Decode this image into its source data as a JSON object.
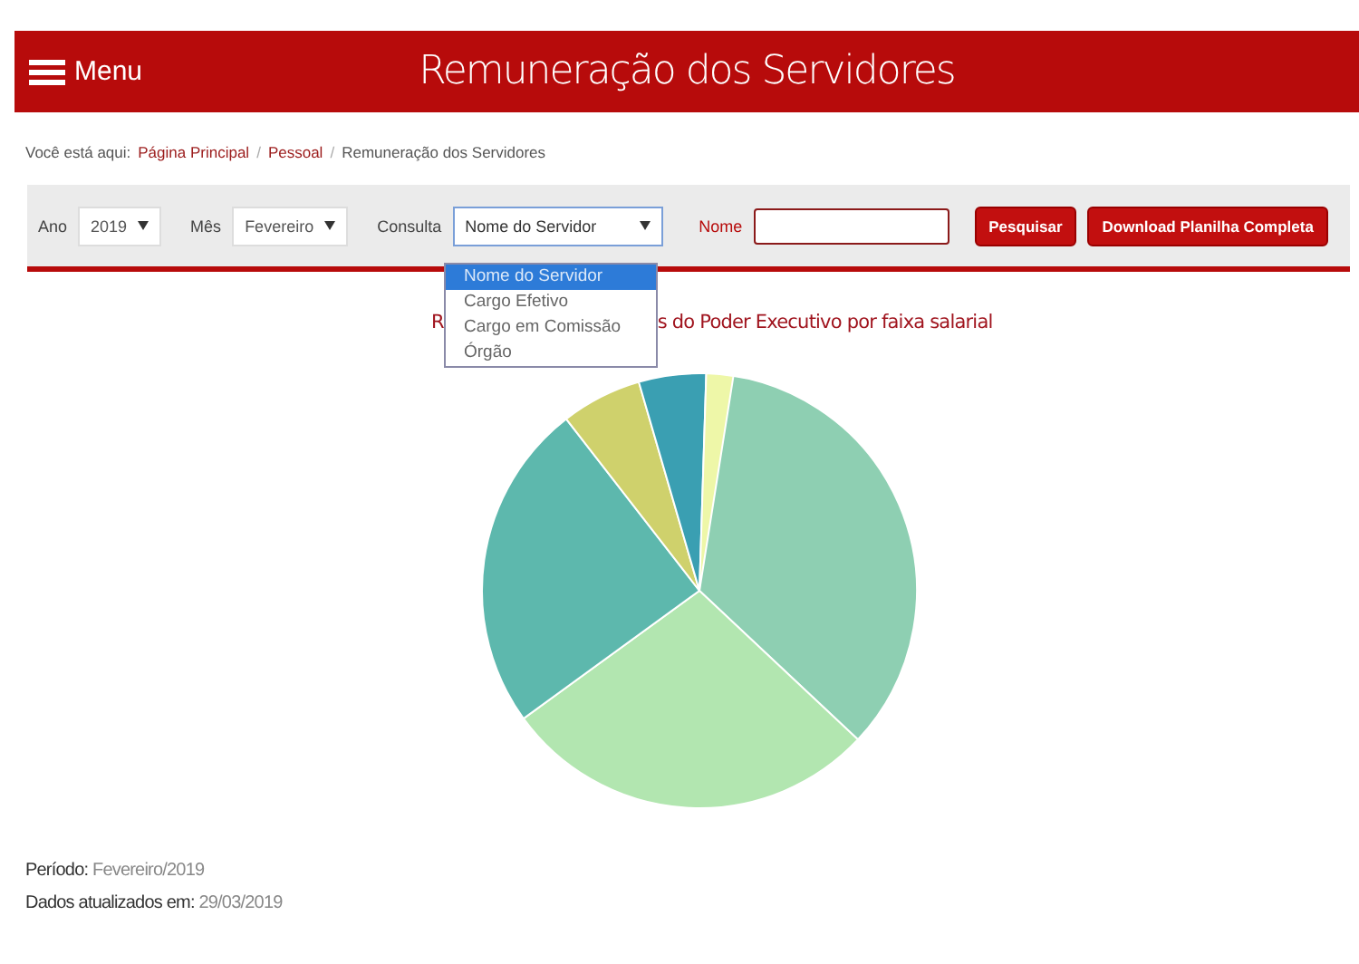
{
  "header": {
    "menu_label": "Menu",
    "title": "Remuneração dos Servidores"
  },
  "breadcrumb": {
    "prefix": "Você está aqui:",
    "links": [
      "Página Principal",
      "Pessoal"
    ],
    "separator": "/",
    "current": "Remuneração dos Servidores"
  },
  "filters": {
    "ano_label": "Ano",
    "ano_value": "2019",
    "mes_label": "Mês",
    "mes_value": "Fevereiro",
    "consulta_label": "Consulta",
    "consulta_value": "Nome do Servidor",
    "nome_label": "Nome",
    "consulta_options": [
      {
        "label": "Nome do Servidor",
        "selected": true
      },
      {
        "label": "Cargo Efetivo",
        "selected": false
      },
      {
        "label": "Cargo em Comissão",
        "selected": false
      },
      {
        "label": "Órgão",
        "selected": false
      }
    ],
    "buttons": [
      "Pesquisar",
      "Download Planilha Completa"
    ]
  },
  "chart_title": {
    "visible_start": "R",
    "visible_end": "s do Poder Executivo por faixa salarial"
  },
  "footer": {
    "periodo_label": "Período:",
    "periodo_value": "Fevereiro/2019",
    "updated_label": "Dados atualizados em:",
    "updated_value": "29/03/2019"
  }
}
